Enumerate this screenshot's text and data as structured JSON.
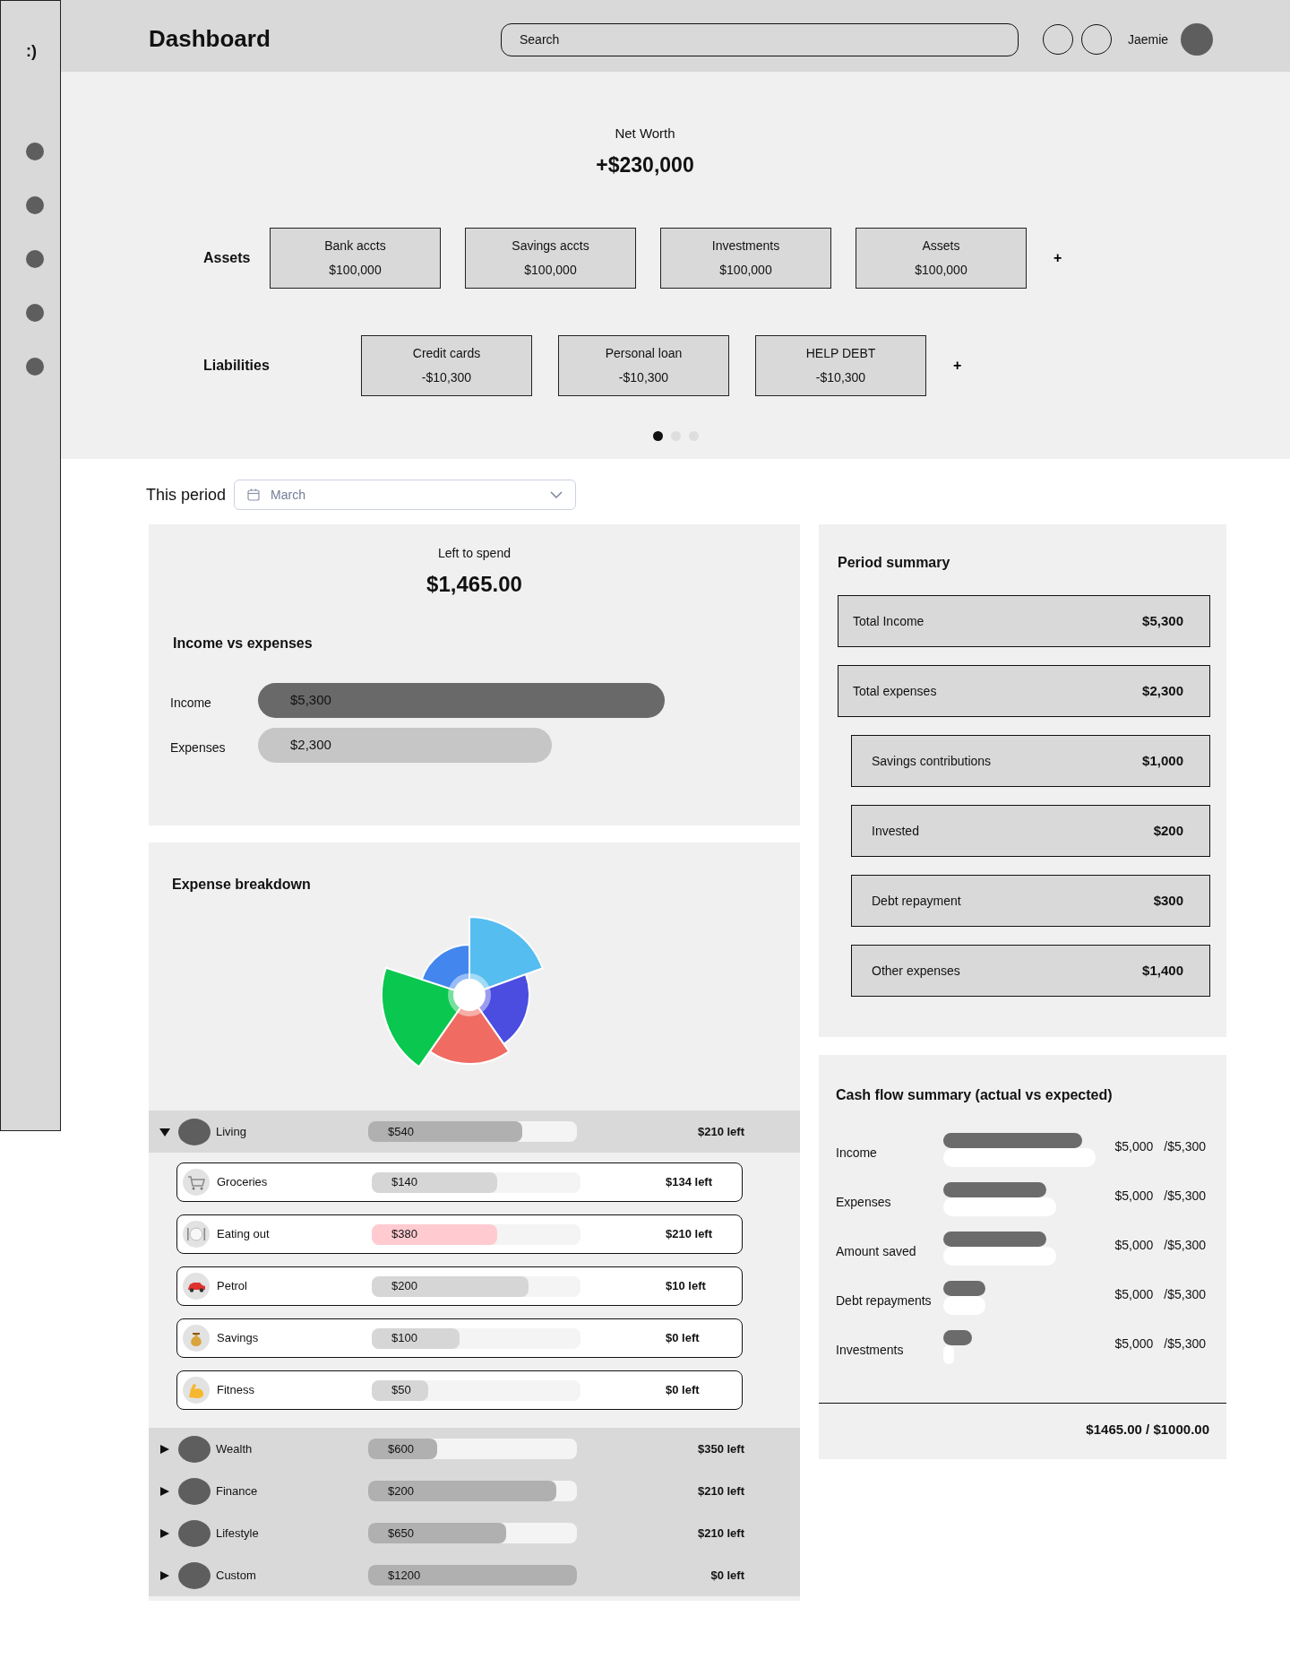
{
  "sidebar": {
    "logo": ":)"
  },
  "header": {
    "title": "Dashboard",
    "search": {
      "placeholder": "Search"
    },
    "user": {
      "name": "Jaemie"
    }
  },
  "net_worth": {
    "label": "Net Worth",
    "value": "+$230,000",
    "assets": {
      "label": "Assets",
      "add": "+",
      "items": [
        {
          "name": "Bank accts",
          "value": "$100,000"
        },
        {
          "name": "Savings accts",
          "value": "$100,000"
        },
        {
          "name": "Investments",
          "value": "$100,000"
        },
        {
          "name": "Assets",
          "value": "$100,000"
        }
      ]
    },
    "liabilities": {
      "label": "Liabilities",
      "add": "+",
      "items": [
        {
          "name": "Credit cards",
          "value": "-$10,300"
        },
        {
          "name": "Personal loan",
          "value": "-$10,300"
        },
        {
          "name": "HELP DEBT",
          "value": "-$10,300"
        }
      ]
    },
    "pages": [
      {
        "selected": true
      },
      {
        "selected": false
      },
      {
        "selected": false
      }
    ]
  },
  "period": {
    "label": "This period",
    "select": {
      "value": "March"
    }
  },
  "left_to_spend": {
    "label": "Left to spend",
    "value": "$1,465.00",
    "section_title": "Income vs expenses",
    "bars": [
      {
        "kind": "income",
        "label": "Income",
        "value": "$5,300"
      },
      {
        "kind": "expense",
        "label": "Expenses",
        "value": "$2,300"
      }
    ]
  },
  "expense_breakdown": {
    "title": "Expense breakdown",
    "groups": [
      {
        "name": "Living",
        "amount": "$540",
        "level": 0.74,
        "left": "$210 left",
        "expanded": true,
        "items": [
          {
            "name": "Groceries",
            "amount": "$140",
            "level": 0.6,
            "left": "$134 left",
            "over_budget": false
          },
          {
            "name": "Eating out",
            "amount": "$380",
            "level": 0.6,
            "left": "$210 left",
            "over_budget": true
          },
          {
            "name": "Petrol",
            "amount": "$200",
            "level": 0.75,
            "left": "$10 left",
            "over_budget": false
          },
          {
            "name": "Savings",
            "amount": "$100",
            "level": 0.42,
            "left": "$0 left",
            "over_budget": false
          },
          {
            "name": "Fitness",
            "amount": "$50",
            "level": 0.27,
            "left": "$0 left",
            "over_budget": false
          }
        ]
      },
      {
        "name": "Wealth",
        "amount": "$600",
        "level": 0.33,
        "left": "$350 left",
        "expanded": false
      },
      {
        "name": "Finance",
        "amount": "$200",
        "level": 0.9,
        "left": "$210 left",
        "expanded": false
      },
      {
        "name": "Lifestyle",
        "amount": "$650",
        "level": 0.66,
        "left": "$210 left",
        "expanded": false
      },
      {
        "name": "Custom",
        "amount": "$1200",
        "level": 1.0,
        "left": "$0 left",
        "expanded": false
      }
    ]
  },
  "period_summary": {
    "title": "Period summary",
    "rows": [
      {
        "kind": "total",
        "label": "Total Income",
        "value": "$5,300"
      },
      {
        "kind": "total",
        "label": "Total expenses",
        "value": "$2,300"
      },
      {
        "kind": "detail",
        "label": "Savings contributions",
        "value": "$1,000"
      },
      {
        "kind": "detail",
        "label": "Invested",
        "value": "$200"
      },
      {
        "kind": "detail",
        "label": "Debt repayment",
        "value": "$300"
      },
      {
        "kind": "detail",
        "label": "Other expenses",
        "value": "$1,400"
      }
    ]
  },
  "cash_flow": {
    "title": "Cash flow summary (actual vs expected)",
    "rows": [
      {
        "label": "Income",
        "actual_value": "$5,000",
        "expected_value": "/$5,300"
      },
      {
        "label": "Expenses",
        "actual_value": "$5,000",
        "expected_value": "/$5,300"
      },
      {
        "label": "Amount saved",
        "actual_value": "$5,000",
        "expected_value": "/$5,300"
      },
      {
        "label": "Debt repayments",
        "actual_value": "$5,000",
        "expected_value": "/$5,300"
      },
      {
        "label": "Investments",
        "actual_value": "$5,000",
        "expected_value": "/$5,300"
      }
    ],
    "total": "$1465.00 / $1000.00"
  }
}
